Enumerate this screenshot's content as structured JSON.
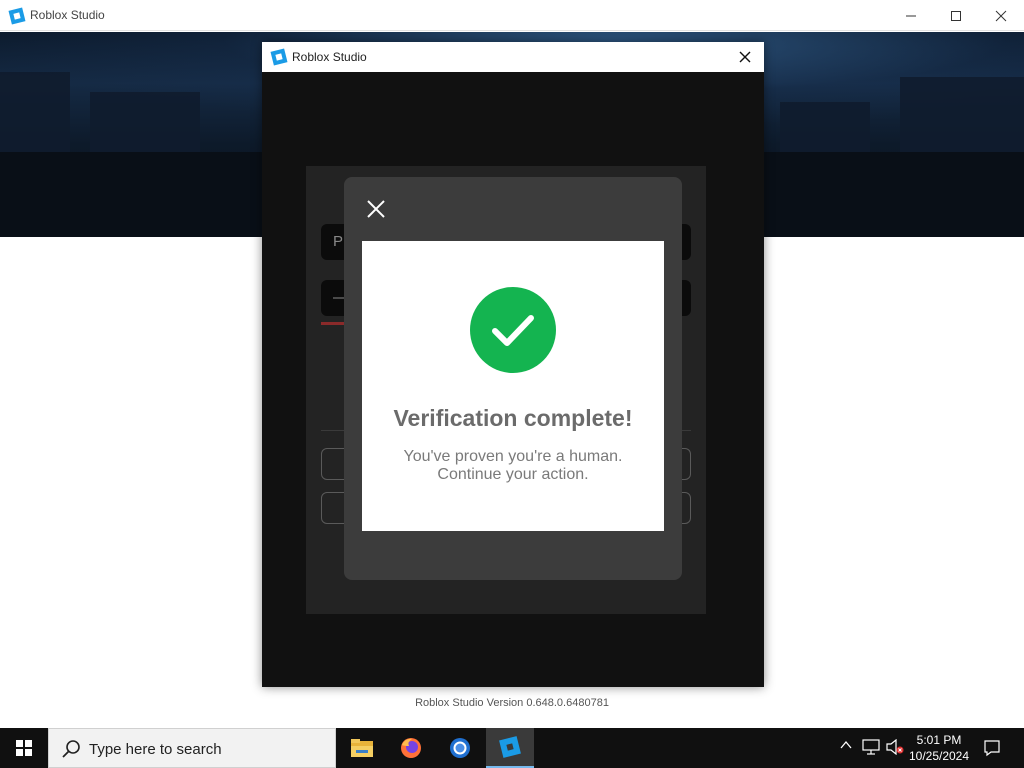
{
  "window": {
    "title": "Roblox Studio",
    "controls": {
      "minimize": "—",
      "maximize": "☐",
      "close": "✕"
    }
  },
  "dialog": {
    "title": "Roblox Studio",
    "close": "✕",
    "fields": {
      "username_partial": "P",
      "password_partial": "—"
    }
  },
  "captcha": {
    "close": "✕",
    "title": "Verification complete!",
    "message_line1": "You've proven you're a human.",
    "message_line2": "Continue your action.",
    "success_color": "#14b450"
  },
  "version_label": "Roblox Studio Version 0.648.0.6480781",
  "taskbar": {
    "search_placeholder": "Type here to search",
    "apps": [
      "file-explorer-icon",
      "firefox-icon",
      "chrome-icon",
      "roblox-studio-icon"
    ],
    "tray": {
      "chevron": "^"
    },
    "clock": {
      "time": "5:01 PM",
      "date": "10/25/2024"
    }
  }
}
